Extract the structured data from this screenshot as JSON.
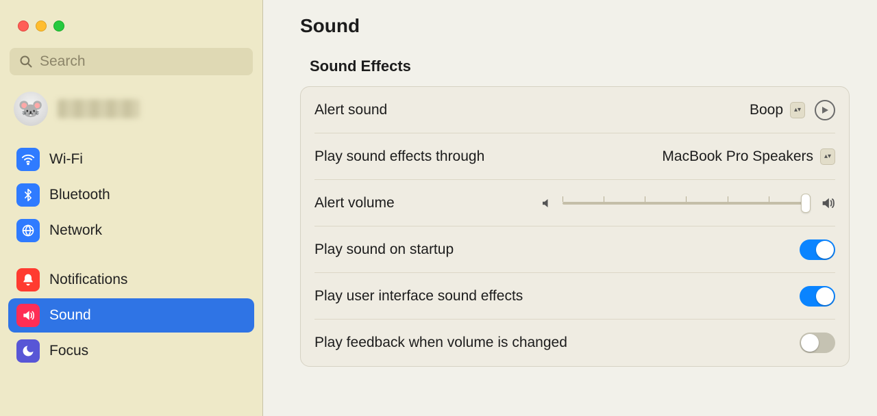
{
  "sidebar": {
    "search_placeholder": "Search",
    "items": [
      {
        "key": "wifi",
        "label": "Wi-Fi",
        "color": "#2f7bff"
      },
      {
        "key": "bluetooth",
        "label": "Bluetooth",
        "color": "#2f7bff"
      },
      {
        "key": "network",
        "label": "Network",
        "color": "#2f7bff"
      },
      {
        "key": "notifications",
        "label": "Notifications",
        "color": "#ff3b30"
      },
      {
        "key": "sound",
        "label": "Sound",
        "color": "#ff2d55"
      },
      {
        "key": "focus",
        "label": "Focus",
        "color": "#5856d6"
      }
    ],
    "selected": "sound"
  },
  "main": {
    "title": "Sound",
    "section_title": "Sound Effects",
    "alert_sound": {
      "label": "Alert sound",
      "value": "Boop"
    },
    "play_through": {
      "label": "Play sound effects through",
      "value": "MacBook Pro Speakers"
    },
    "alert_volume": {
      "label": "Alert volume",
      "value": 98
    },
    "play_startup": {
      "label": "Play sound on startup",
      "on": true
    },
    "play_ui_effects": {
      "label": "Play user interface sound effects",
      "on": true
    },
    "play_feedback": {
      "label": "Play feedback when volume is changed",
      "on": false
    }
  }
}
